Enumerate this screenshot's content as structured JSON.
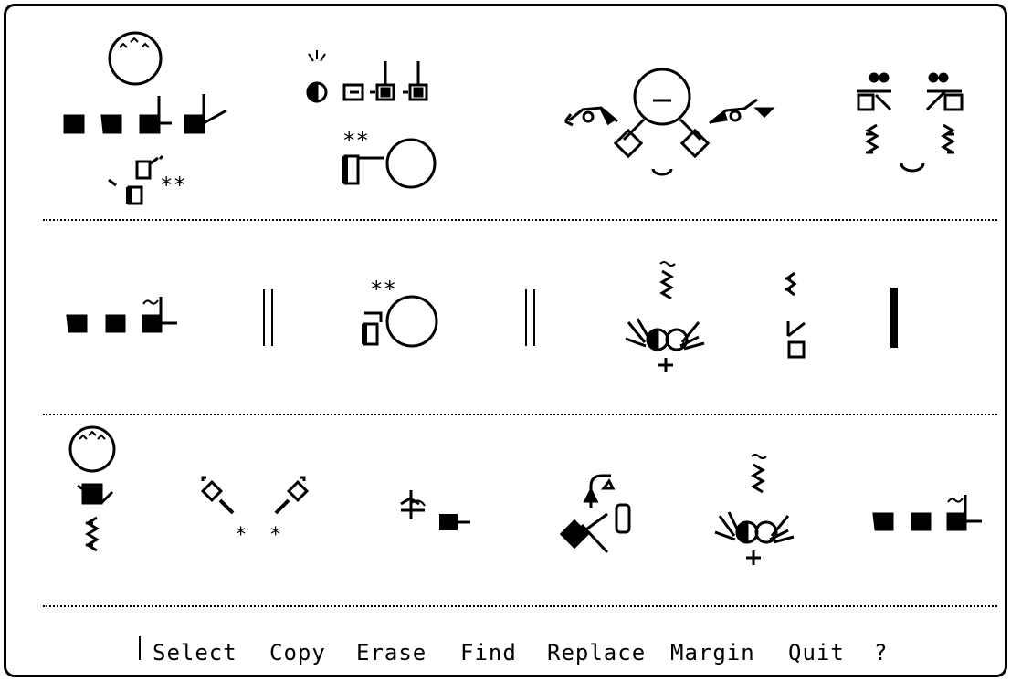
{
  "menu": {
    "items": [
      "Select",
      "Copy",
      "Erase",
      "Find",
      "Replace",
      "Margin",
      "Quit",
      "?"
    ]
  },
  "canvas": {
    "type": "SignWriting editor",
    "rows": 3,
    "ink_color": "#000000",
    "background_color": "#ffffff"
  }
}
